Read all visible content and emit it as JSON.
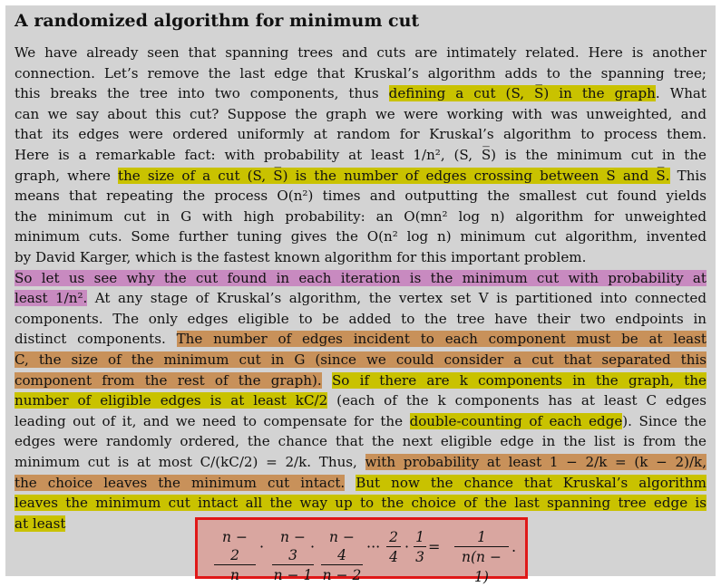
{
  "title": "A randomized algorithm for minimum cut",
  "lines": [
    [
      {
        "t": "We have already seen that spanning trees and cuts are intimately related. Here is another"
      }
    ],
    [
      {
        "t": "connection. Let’s remove the last edge that Kruskal’s algorithm adds to the spanning tree;"
      }
    ],
    [
      {
        "t": "this breaks the tree into two components, thus "
      },
      {
        "t": "defining a cut (S, S̅) in the graph",
        "h": "y"
      },
      {
        "t": ". What"
      }
    ],
    [
      {
        "t": "can we say about this cut? Suppose the graph we were working with was unweighted, and"
      }
    ],
    [
      {
        "t": "that its edges were ordered uniformly at random for Kruskal’s algorithm to process them."
      }
    ],
    [
      {
        "t": "Here is a remarkable fact: with probability at least 1/n², (S, S̅) is the minimum cut in the"
      }
    ],
    [
      {
        "t": "graph, where "
      },
      {
        "t": "the size of a cut (S, S̅) is the number of edges crossing between S and S̅.",
        "h": "y"
      },
      {
        "t": " This"
      }
    ],
    [
      {
        "t": "means that repeating the process O(n²) times and outputting the smallest cut found yields"
      }
    ],
    [
      {
        "t": "the minimum cut in G with high probability: an O(mn² log n) algorithm for unweighted"
      }
    ],
    [
      {
        "t": "minimum cuts. Some further tuning gives the O(n² log n) minimum cut algorithm, invented"
      }
    ],
    [
      {
        "t": "by David Karger, which is the fastest known algorithm for this important problem."
      }
    ],
    [
      {
        "t": "    "
      },
      {
        "t": "So let us see why the cut found in each iteration is the minimum cut with probability at",
        "h": "p"
      }
    ],
    [
      {
        "t": "least 1/n².",
        "h": "p"
      },
      {
        "t": " At any stage of Kruskal’s algorithm, the vertex set V is partitioned into connected"
      }
    ],
    [
      {
        "t": "components. The only edges eligible to be added to the tree have their two endpoints in"
      }
    ],
    [
      {
        "t": "distinct components. "
      },
      {
        "t": "The number of edges incident to each component must be at least",
        "h": "o"
      }
    ],
    [
      {
        "t": "C, the size of the minimum cut in G (since we could consider a cut that separated this",
        "h": "o"
      }
    ],
    [
      {
        "t": "component from the rest of the graph).",
        "h": "o"
      },
      {
        "t": " "
      },
      {
        "t": "So if there are k components in the graph, the",
        "h": "y"
      }
    ],
    [
      {
        "t": "number of eligible edges is at least kC/2",
        "h": "y"
      },
      {
        "t": " (each of the k components has at least C edges"
      }
    ],
    [
      {
        "t": "leading out of it, and we need to compensate for the "
      },
      {
        "t": "double-counting of each edge",
        "h": "y"
      },
      {
        "t": "). Since the"
      }
    ],
    [
      {
        "t": "edges were randomly ordered, the chance that the next eligible edge in the list is from the"
      }
    ],
    [
      {
        "t": "minimum cut is at most C/(kC/2) = 2/k. Thus, "
      },
      {
        "t": "with probability at least 1 − 2/k = (k − 2)/k,",
        "h": "o"
      }
    ],
    [
      {
        "t": "the choice leaves the minimum cut intact.",
        "h": "o"
      },
      {
        "t": " "
      },
      {
        "t": "But now the chance that Kruskal’s algorithm",
        "h": "y"
      }
    ],
    [
      {
        "t": "leaves the minimum cut intact all the way up to the choice of the last spanning tree edge is",
        "h": "y"
      }
    ],
    [
      {
        "t": "at least",
        "h": "y"
      }
    ]
  ],
  "formula": {
    "fractions": [
      {
        "num": "n − 2",
        "den": "n"
      },
      {
        "num": "n − 3",
        "den": "n − 1"
      },
      {
        "num": "n − 4",
        "den": "n − 2"
      },
      {
        "num": "2",
        "den": "4"
      },
      {
        "num": "1",
        "den": "3"
      },
      {
        "num": "1",
        "den": "n(n − 1)"
      }
    ],
    "ops": [
      "·",
      "·",
      "···",
      "·",
      "=",
      "."
    ]
  }
}
